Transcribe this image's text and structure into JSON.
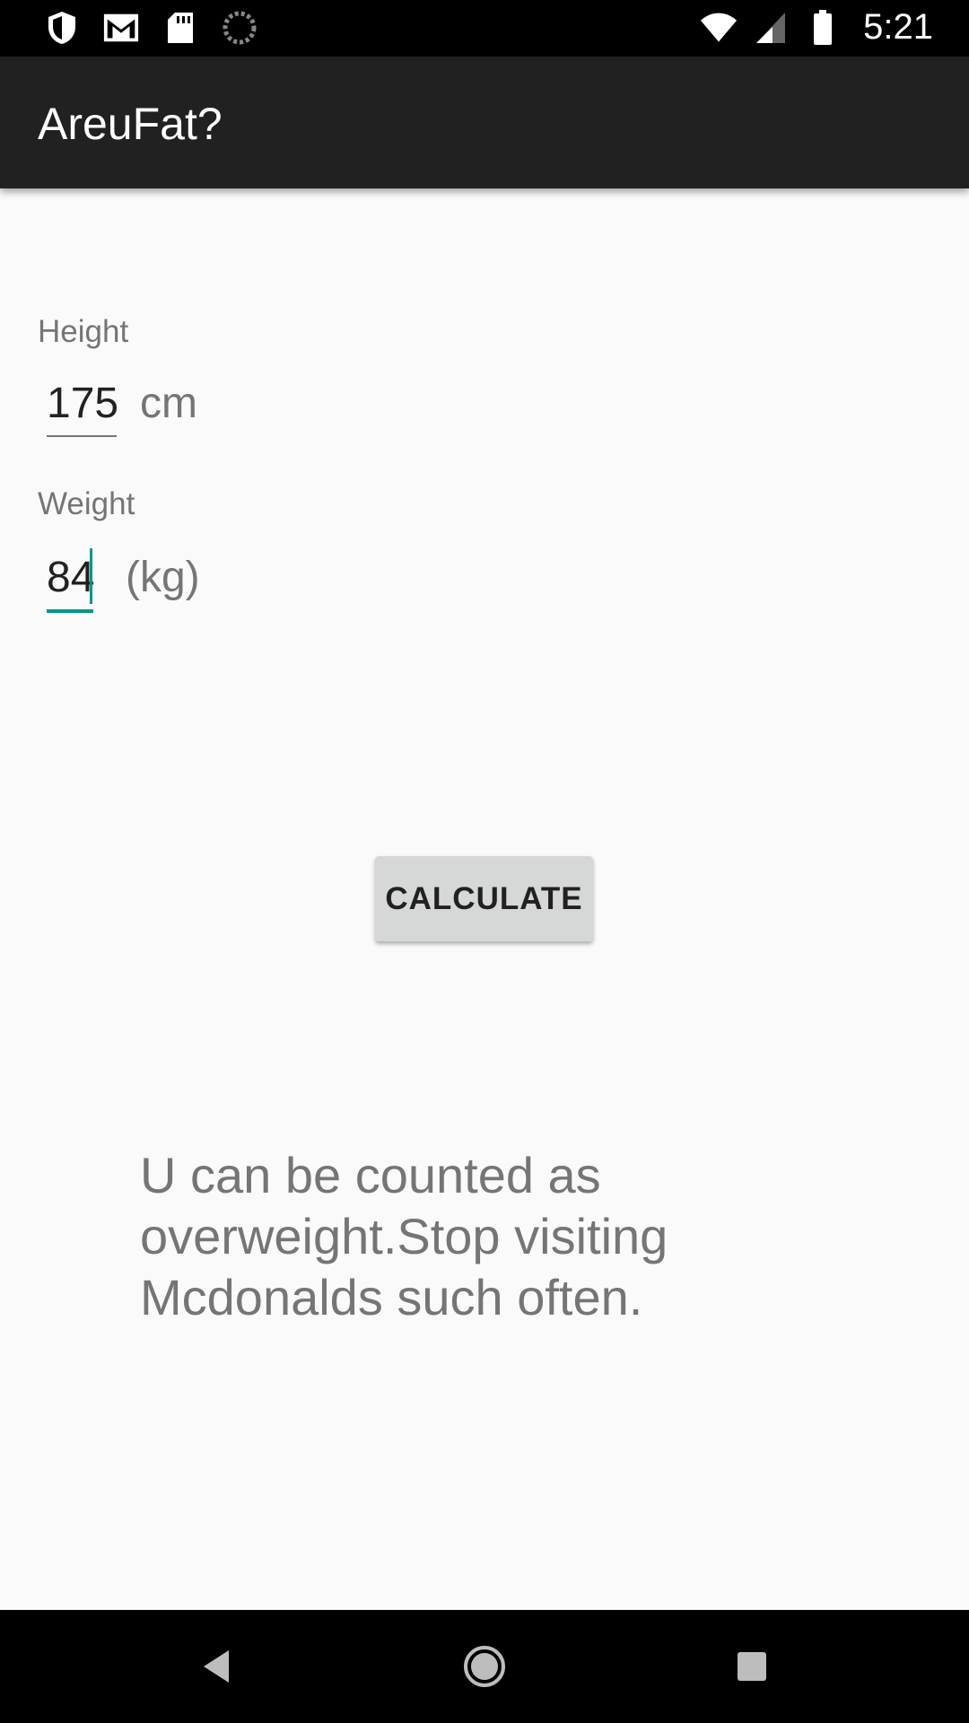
{
  "status_bar": {
    "time": "5:21",
    "left_icons": [
      "shield-icon",
      "gmail-icon",
      "sd-card-icon",
      "sync-icon"
    ],
    "right_icons": [
      "wifi-icon",
      "signal-icon",
      "battery-icon"
    ]
  },
  "app_bar": {
    "title": "AreuFat?"
  },
  "form": {
    "height": {
      "label": "Height",
      "value": "175",
      "unit": "cm"
    },
    "weight": {
      "label": "Weight",
      "value": "84",
      "unit": "(kg)"
    }
  },
  "calculate_button": {
    "label": "CALCULATE"
  },
  "result": {
    "text": "U can be counted as overweight.Stop visiting Mcdonalds such often."
  },
  "nav_bar": {
    "buttons": [
      "back-icon",
      "home-icon",
      "recents-icon"
    ]
  },
  "colors": {
    "app_bar": "#212121",
    "accent": "#009688",
    "background": "#fafafa",
    "button": "#d6d7d7"
  }
}
